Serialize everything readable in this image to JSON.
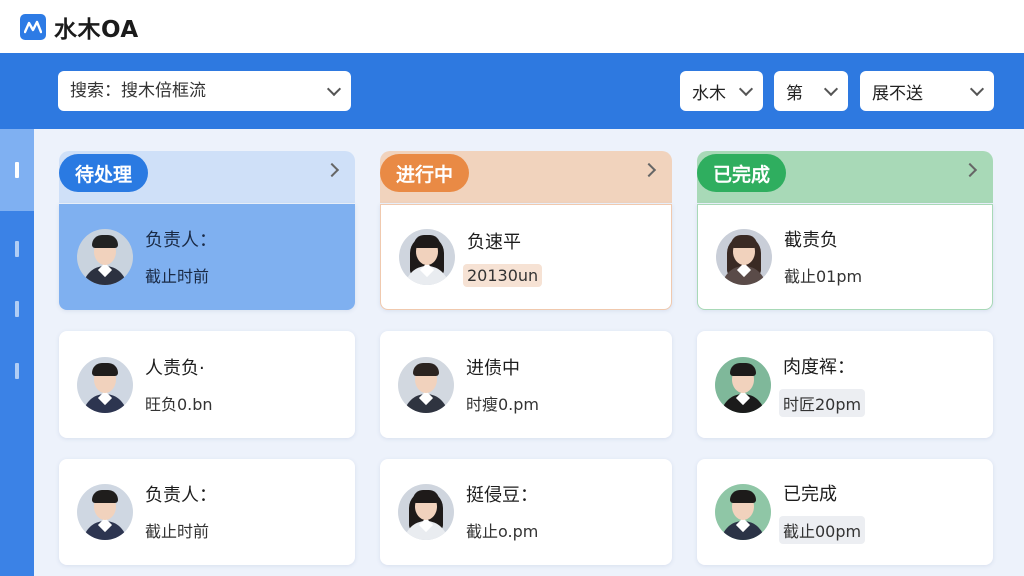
{
  "app": {
    "title": "水木OA"
  },
  "filters": {
    "search_placeholder": "搜索：搜木倍框流",
    "select1": "水木",
    "select2": "第",
    "select3": "展不送"
  },
  "columns": [
    {
      "label": "待处理",
      "color": "#2a7ae2",
      "header_bg": "#cfe0f8"
    },
    {
      "label": "进行中",
      "color": "#e98a45",
      "header_bg": "#f1d3bd"
    },
    {
      "label": "已完成",
      "color": "#2fae5f",
      "header_bg": "#a8d9b7"
    }
  ],
  "cards": [
    [
      {
        "title": "负责人：",
        "sub": "截止时前",
        "avatar": "male-suit",
        "highlight": true
      },
      {
        "title": "人责负·",
        "sub": "旺负0.bn",
        "avatar": "male-glasses"
      },
      {
        "title": "负责人：",
        "sub": "截止时前",
        "avatar": "male-glasses"
      }
    ],
    [
      {
        "title": "负速平",
        "sub": "20130un",
        "avatar": "female-long",
        "sub_style": "peach"
      },
      {
        "title": "进债中",
        "sub": "时瘦0.pm",
        "avatar": "female-short"
      },
      {
        "title": "挺侵豆：",
        "sub": "截止o.pm",
        "avatar": "female-long"
      }
    ],
    [
      {
        "title": "截责负",
        "sub": "截止01pm",
        "avatar": "female-wavy"
      },
      {
        "title": "肉度裈：",
        "sub": "时匠20pm",
        "avatar": "male-casual",
        "sub_style": "gray"
      },
      {
        "title": "已完成",
        "sub": "截止00pm",
        "avatar": "male-glasses-green",
        "sub_style": "gray"
      }
    ]
  ]
}
